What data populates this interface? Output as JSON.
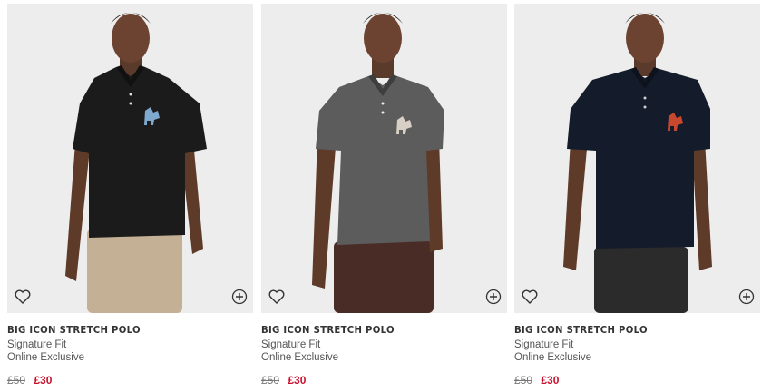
{
  "products": [
    {
      "name": "BIG ICON STRETCH POLO",
      "fit": "Signature Fit",
      "tag": "Online Exclusive",
      "original_price": "£50",
      "sale_price": "£30",
      "shirt_color": "#1b1b1b",
      "logo_color": "#7fa8cf",
      "pants_color": "#c3b095"
    },
    {
      "name": "BIG ICON STRETCH POLO",
      "fit": "Signature Fit",
      "tag": "Online Exclusive",
      "original_price": "£50",
      "sale_price": "£30",
      "shirt_color": "#5c5c5c",
      "logo_color": "#d8d0c4",
      "pants_color": "#4a2c27"
    },
    {
      "name": "BIG ICON STRETCH POLO",
      "fit": "Signature Fit",
      "tag": "Online Exclusive",
      "original_price": "£50",
      "sale_price": "£30",
      "shirt_color": "#141b2b",
      "logo_color": "#c8472f",
      "pants_color": "#2b2b2b"
    }
  ],
  "icons": {
    "wishlist": "heart-outline-icon",
    "quick_add": "plus-circle-icon"
  },
  "colors": {
    "sale": "#c8102e",
    "photo_background": "#ededed"
  }
}
